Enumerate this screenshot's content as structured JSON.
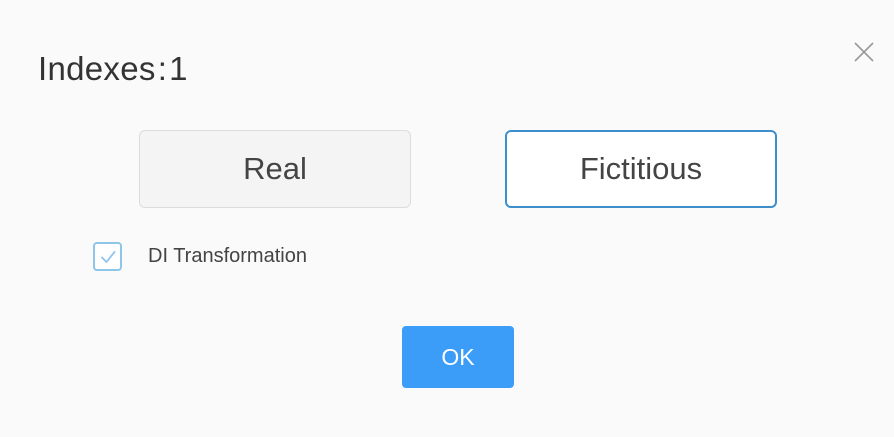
{
  "dialog": {
    "title_label": "Indexes",
    "title_separator": ":",
    "title_value": "1",
    "close_icon": "close-icon"
  },
  "options": {
    "real_label": "Real",
    "fictitious_label": "Fictitious",
    "selected": "Fictitious"
  },
  "transformation": {
    "label": "DI Transformation",
    "checked": true
  },
  "footer": {
    "ok_label": "OK"
  },
  "colors": {
    "accent": "#3b9df8",
    "selected_border": "#3d8fcc",
    "checkbox_border": "#8ec5ea",
    "background": "#fafafa"
  }
}
